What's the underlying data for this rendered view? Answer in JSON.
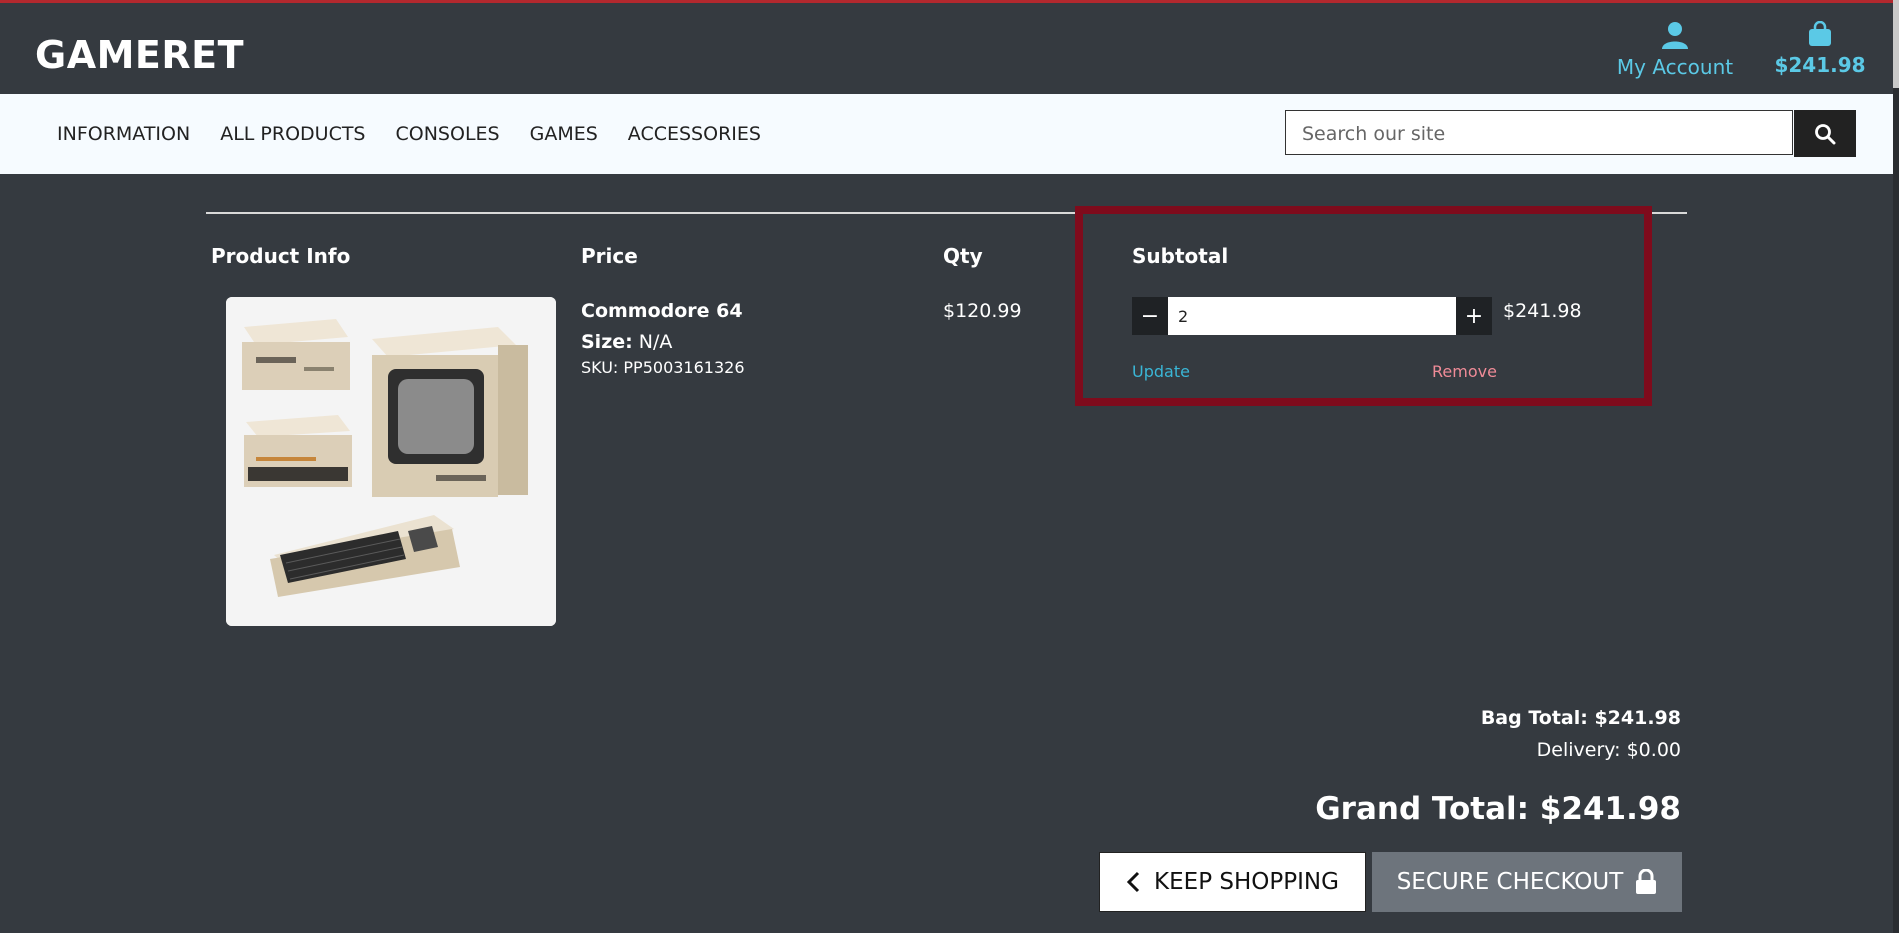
{
  "header": {
    "logo": "GAMERET",
    "account_label": "My Account",
    "bag_total": "$241.98",
    "account_icon": "user-icon",
    "bag_icon": "shopping-bag-icon"
  },
  "nav": {
    "items": [
      "INFORMATION",
      "ALL PRODUCTS",
      "CONSOLES",
      "GAMES",
      "ACCESSORIES"
    ],
    "search_placeholder": "Search our site",
    "search_icon": "search-icon"
  },
  "cart": {
    "columns": [
      "Product Info",
      "Price",
      "Qty",
      "Subtotal"
    ],
    "item": {
      "name": "Commodore 64",
      "size_label": "Size:",
      "size_value": "N/A",
      "sku": "SKU: PP5003161326",
      "price": "$120.99",
      "qty": "2",
      "subtotal": "$241.98",
      "update_label": "Update",
      "remove_label": "Remove",
      "minus_label": "−",
      "plus_label": "+"
    }
  },
  "totals": {
    "bag_total": "Bag Total: $241.98",
    "delivery": "Delivery: $0.00",
    "grand_total": "Grand Total: $241.98"
  },
  "actions": {
    "keep_shopping": "KEEP SHOPPING",
    "secure_checkout": "SECURE CHECKOUT"
  },
  "colors": {
    "header_bg": "#353a40",
    "accent": "#5bc9e6",
    "highlight": "#7f0b1c",
    "remove": "#ef8b97"
  }
}
